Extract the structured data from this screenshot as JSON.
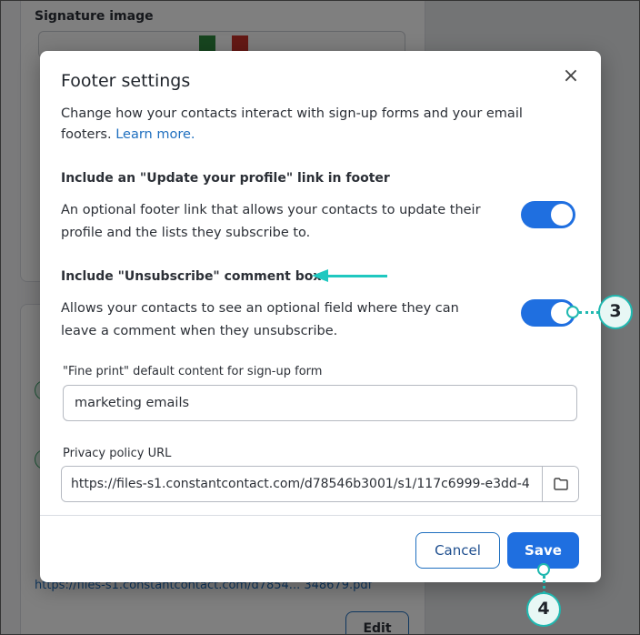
{
  "background": {
    "signature_heading": "Signature image",
    "link_text": "https://files-s1.constantcontact.com/d7854... 348679.pdf",
    "edit_label": "Edit"
  },
  "modal": {
    "title": "Footer settings",
    "close_icon": "close-icon",
    "description": "Change how your contacts interact with sign-up forms and your email footers.",
    "learn_more": "Learn more.",
    "profile_section": {
      "title": "Include an \"Update your profile\" link in footer",
      "description": "An optional footer link that allows your contacts to update their profile and the lists they subscribe to.",
      "enabled": true
    },
    "unsubscribe_section": {
      "title": "Include \"Unsubscribe\" comment box",
      "description": "Allows your contacts to see an optional field where they can leave a comment when they unsubscribe.",
      "enabled": true
    },
    "fine_print": {
      "label": "\"Fine print\" default content for sign-up form",
      "value": "marketing emails"
    },
    "privacy": {
      "label": "Privacy policy URL",
      "value": "https://files-s1.constantcontact.com/d78546b3001/s1/117c6999-e3dd-4",
      "icon": "folder-icon"
    },
    "cancel_label": "Cancel",
    "save_label": "Save"
  },
  "annotations": {
    "step_3": "3",
    "step_4": "4",
    "accent_color": "#1fb8b0"
  }
}
